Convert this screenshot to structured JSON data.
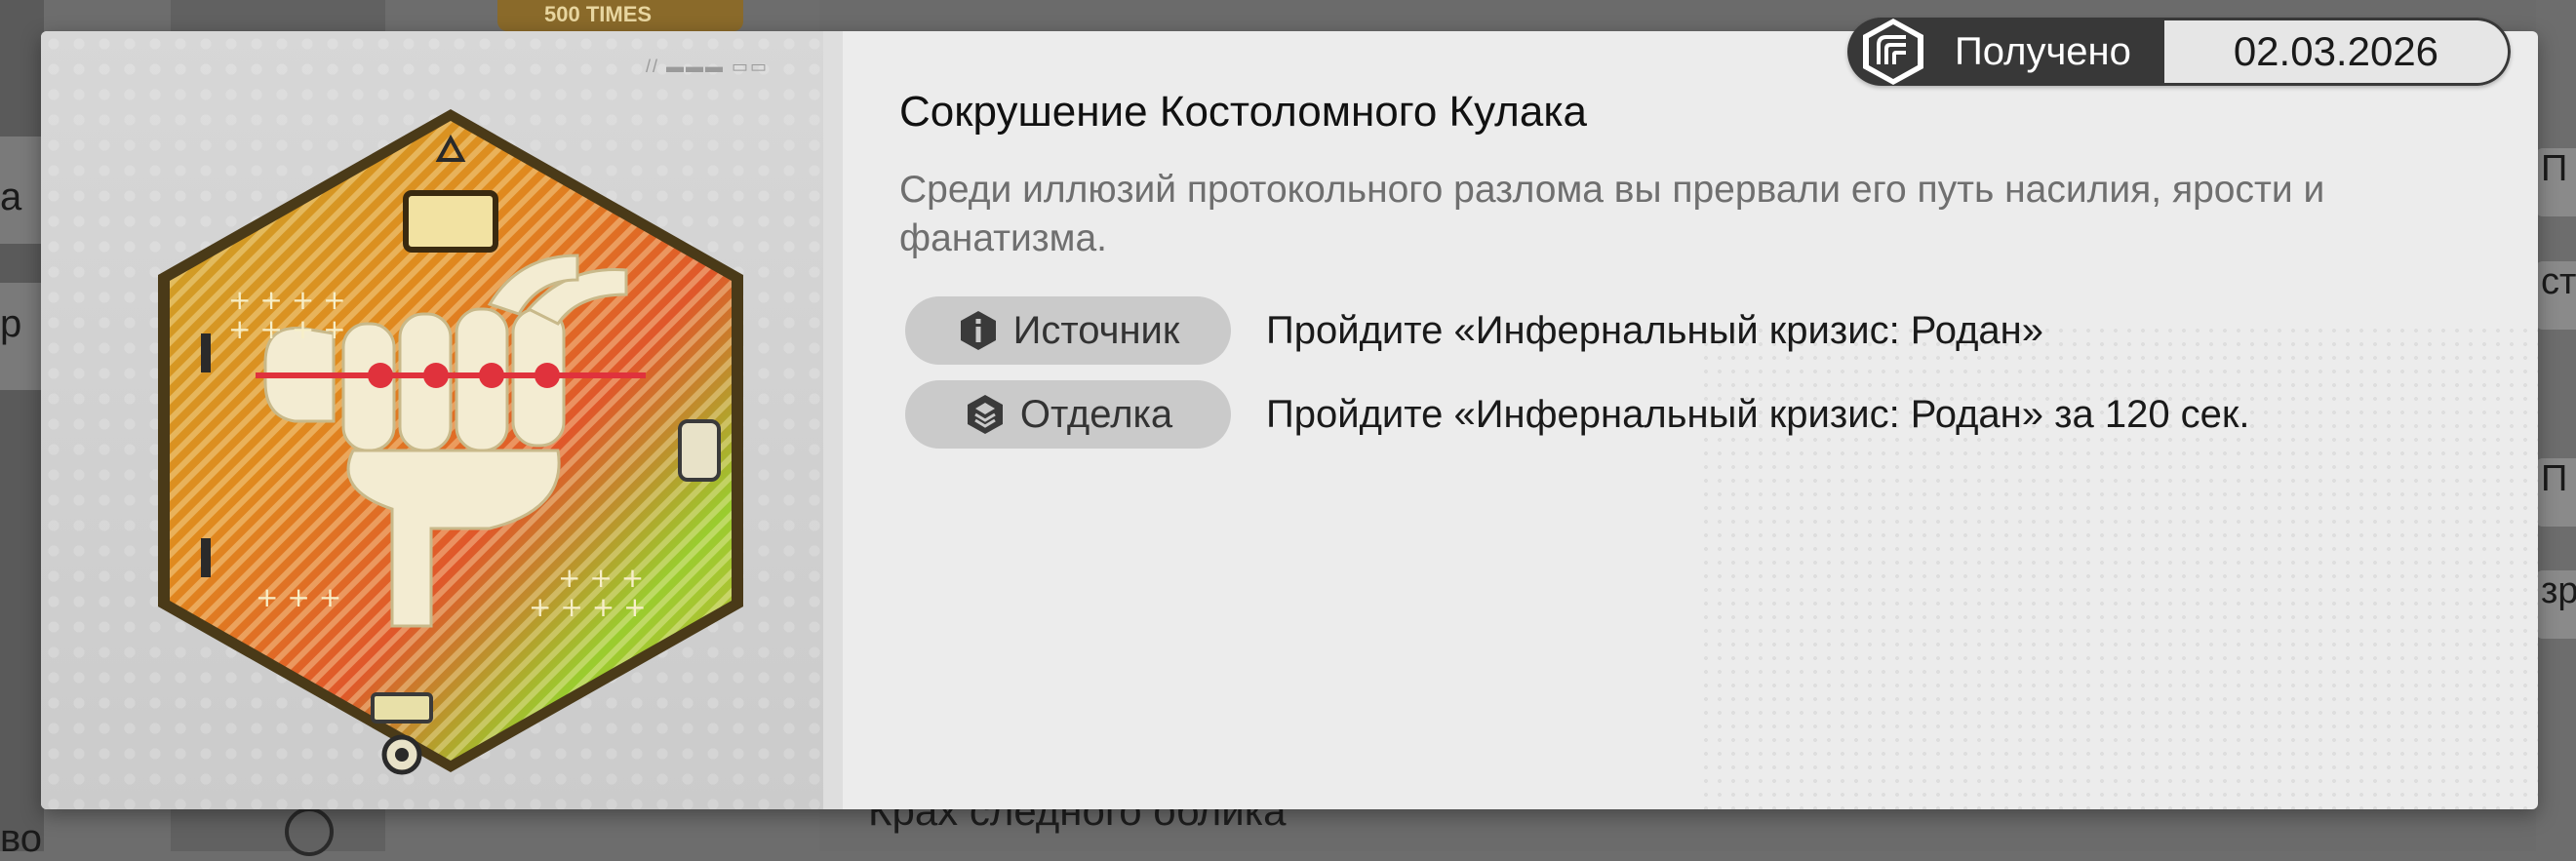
{
  "background": {
    "left_labels": [
      "а",
      "р",
      "во"
    ],
    "thumb_label": "500 TIMES",
    "bottom_title": "Крах следного облика",
    "right_cards": [
      "П",
      "ст",
      "П",
      "зр"
    ]
  },
  "achievement": {
    "title": "Сокрушение Костоломного Кулака",
    "description": "Среди иллюзий протокольного разлома вы прервали его путь насилия, ярости и фанатизма.",
    "status": {
      "label": "Получено",
      "date": "02.03.2026",
      "icon": "achievement-emblem-icon"
    },
    "requirements": [
      {
        "chip_label": "Источник",
        "icon": "info-icon",
        "text": "Пройдите «Инфернальный кризис: Родан»"
      },
      {
        "chip_label": "Отделка",
        "icon": "stack-layers-icon",
        "text": "Пройдите «Инфернальный кризис: Родан» за 120 сек."
      }
    ]
  },
  "colors": {
    "modal_bg": "#ececec",
    "pill_dark": "#383838",
    "chip_bg": "#cacaca",
    "badge_red": "#e0323c",
    "badge_gold": "#c9a72a"
  }
}
